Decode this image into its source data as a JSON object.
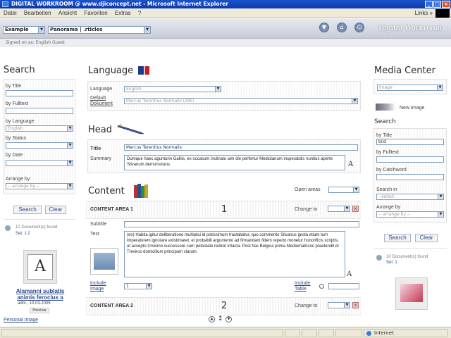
{
  "window": {
    "title": "DIGITAL WORKROOM @ www.djiconcept.net - Microsoft Internet Explorer",
    "minimize": "_",
    "maximize": "□",
    "close": "×"
  },
  "menu": {
    "items": [
      "Datei",
      "Bearbeiten",
      "Ansicht",
      "Favoriten",
      "Extras",
      "?"
    ],
    "links": "Links"
  },
  "header": {
    "language_select": "Example",
    "section_select": "Panorama | .rticles",
    "brand": "Digital Workroom",
    "signed_on": "Signed on as: English Guest"
  },
  "search": {
    "heading": "Search",
    "by_title": "by Title",
    "by_fulltext": "by Fulltext",
    "by_language": "by Language",
    "language_value": "English",
    "by_status": "by Status",
    "by_date": "by Date",
    "arrange_by": "Arrange by",
    "arrange_value": "-- arrange by --",
    "search_btn": "Search",
    "clear_btn": "Clear",
    "found": "12 Document(s) found",
    "set": "Set: 1 2",
    "doc_title": "Alamanni sublatis animis ferocius a",
    "doc_meta": "adm., 10.03.2005",
    "preview": "Preview",
    "doc_letter": "A",
    "personal_image": "Personal Image"
  },
  "language": {
    "heading": "Language",
    "language_label": "Language",
    "language_value": "English",
    "default_doc_label_1": "Default",
    "default_doc_label_2": "Dokument",
    "default_doc_value": "Marcus Terentius Normalis (285)"
  },
  "head": {
    "heading": "Head",
    "title_label": "Title",
    "title_value": "Marcus Terentius Normalis",
    "summary_label": "Summary",
    "summary_value": "Dumque haec agunturin Galliis, ex occasum inclinato iam die perfertur Mediolanum insperabilis nuntius aperte Silvanum demonstrans.",
    "spell_icon": "A"
  },
  "content": {
    "heading": "Content",
    "open_areas": "Open areas",
    "area1_title": "CONTENT AREA  1",
    "area1_num": "1",
    "change_to": "Change to",
    "subtitle_label": "Subtitle",
    "text_label": "Text",
    "text_value": "(en) Habita igitur deliberatione multiplici id potissimum tractabatur, quo commento Silvanus gesta etiam tum imperatorem ignorare existimaret. et probabili argumento ad firmandam fidem reperto monetur honorificis scriptis, ut accepto Ursicino successore cum potestate rediret intacta. Post has Belgica prima Mediomatricos praetendit et Treviros domicilium principum clarum.",
    "include_image_1": "Include",
    "include_image_2": "Image",
    "include_image_value": "1",
    "include_table_1": "Include",
    "include_table_2": "Table",
    "area2_title": "CONTENT AREA  2",
    "area2_num": "2",
    "x_btn": "x"
  },
  "media": {
    "heading": "Media Center",
    "type_value": "Image",
    "new_image": "New Image",
    "search_heading": "Search",
    "by_title": "by Title",
    "title_value": "bild",
    "by_fulltext": "by Fulltext",
    "by_catchword": "by Catchword",
    "search_in": "Search in",
    "search_in_value": "--select--",
    "arrange_by": "Arrange by",
    "arrange_value": "-- arrange by --",
    "search_btn": "Search",
    "clear_btn": "Clear",
    "found": "10 Document(s) found",
    "set": "Set: 1"
  },
  "status": {
    "zone": "Internet"
  },
  "colors": {
    "titlebar": "#0a3bb0",
    "link": "#2a4a8a",
    "xp_chrome": "#ece9d8"
  }
}
